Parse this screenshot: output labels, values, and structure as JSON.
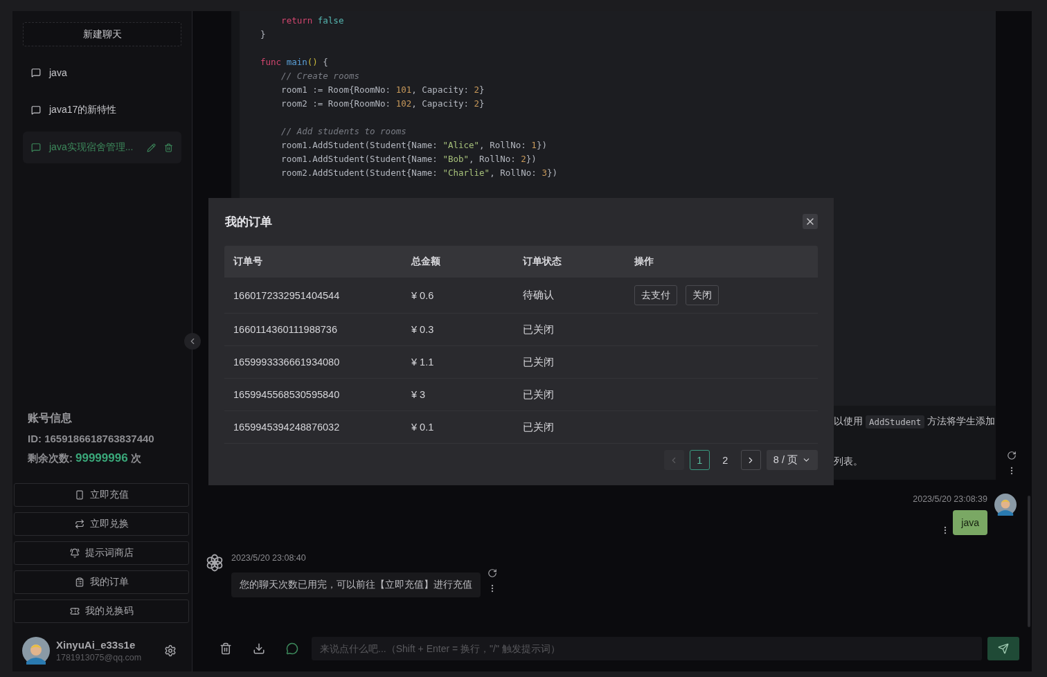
{
  "sidebar": {
    "new_chat_button": "新建聊天",
    "conversations": [
      {
        "title": "java",
        "selected": false
      },
      {
        "title": "java17的新特性",
        "selected": false
      },
      {
        "title": "java实现宿舍管理...",
        "selected": true
      }
    ],
    "account": {
      "title": "账号信息",
      "id": "ID: 1659186618763837440",
      "remaining_label": "剩余次数:",
      "remaining_value": "99999996",
      "remaining_unit": "次"
    },
    "actions": [
      {
        "kind": "recharge",
        "label": "立即充值"
      },
      {
        "kind": "exchange",
        "label": "立即兑换"
      },
      {
        "kind": "prompts",
        "label": "提示词商店"
      },
      {
        "kind": "orders",
        "label": "我的订单"
      },
      {
        "kind": "codes",
        "label": "我的兑换码"
      }
    ],
    "user": {
      "name": "XinyuAi_e33s1e",
      "email": "1781913075@qq.com"
    }
  },
  "chat": {
    "messages": [
      {
        "kind": "assistant",
        "code_lines": [
          {
            "gap_before": false,
            "tokens": [
              {
                "kind": "keyword",
                "text": "    return"
              },
              {
                "kind": "literal",
                "text": " false"
              }
            ]
          },
          {
            "gap_before": false,
            "tokens": [
              {
                "kind": "plain",
                "text": "}"
              }
            ]
          },
          {
            "gap_before": true,
            "tokens": [
              {
                "kind": "keyword",
                "text": "func"
              },
              {
                "kind": "function",
                "text": " main"
              },
              {
                "kind": "paren",
                "text": "()"
              },
              {
                "kind": "plain",
                "text": " {"
              }
            ]
          },
          {
            "gap_before": false,
            "tokens": [
              {
                "kind": "comment",
                "text": "    // Create rooms"
              }
            ]
          },
          {
            "gap_before": false,
            "tokens": [
              {
                "kind": "plain",
                "text": "    room1 := Room{RoomNo: "
              },
              {
                "kind": "number",
                "text": "101"
              },
              {
                "kind": "plain",
                "text": ", Capacity: "
              },
              {
                "kind": "number",
                "text": "2"
              },
              {
                "kind": "plain",
                "text": "}"
              }
            ]
          },
          {
            "gap_before": false,
            "tokens": [
              {
                "kind": "plain",
                "text": "    room2 := Room{RoomNo: "
              },
              {
                "kind": "number",
                "text": "102"
              },
              {
                "kind": "plain",
                "text": ", Capacity: "
              },
              {
                "kind": "number",
                "text": "2"
              },
              {
                "kind": "plain",
                "text": "}"
              }
            ]
          },
          {
            "gap_before": true,
            "tokens": [
              {
                "kind": "comment",
                "text": "    // Add students to rooms"
              }
            ]
          },
          {
            "gap_before": false,
            "tokens": [
              {
                "kind": "plain",
                "text": "    room1.AddStudent(Student{Name: "
              },
              {
                "kind": "string",
                "text": "\"Alice\""
              },
              {
                "kind": "plain",
                "text": ", RollNo: "
              },
              {
                "kind": "number",
                "text": "1"
              },
              {
                "kind": "plain",
                "text": "})"
              }
            ]
          },
          {
            "gap_before": false,
            "tokens": [
              {
                "kind": "plain",
                "text": "    room1.AddStudent(Student{Name: "
              },
              {
                "kind": "string",
                "text": "\"Bob\""
              },
              {
                "kind": "plain",
                "text": ", RollNo: "
              },
              {
                "kind": "number",
                "text": "2"
              },
              {
                "kind": "plain",
                "text": "})"
              }
            ]
          },
          {
            "gap_before": false,
            "tokens": [
              {
                "kind": "plain",
                "text": "    room2.AddStudent(Student{Name: "
              },
              {
                "kind": "string",
                "text": "\"Charlie\""
              },
              {
                "kind": "plain",
                "text": ", RollNo: "
              },
              {
                "kind": "number",
                "text": "3"
              },
              {
                "kind": "plain",
                "text": "})"
              }
            ]
          }
        ],
        "text_lines": [
          [
            {
              "kind": "text",
              "text": "以使用"
            },
            {
              "kind": "code",
              "text": "AddStudent"
            },
            {
              "kind": "text",
              "text": "方法将学生添加"
            }
          ],
          [
            {
              "kind": "text",
              "text": "列表。"
            }
          ]
        ]
      },
      {
        "kind": "user",
        "time": "2023/5/20 23:08:39",
        "text": "java"
      },
      {
        "kind": "assistant",
        "time": "2023/5/20 23:08:40",
        "text": "您的聊天次数已用完，可以前往【立即充值】进行充值"
      }
    ],
    "input": {
      "placeholder": "来说点什么吧...（Shift + Enter = 换行，\"/\" 触发提示词）"
    }
  },
  "modal": {
    "title": "我的订单",
    "columns": [
      "订单号",
      "总金额",
      "订单状态",
      "操作"
    ],
    "rows": [
      {
        "order_no": "1660172332951404544",
        "amount": "¥ 0.6",
        "status": "待确认",
        "actions": [
          "去支付",
          "关闭"
        ]
      },
      {
        "order_no": "1660114360111988736",
        "amount": "¥ 0.3",
        "status": "已关闭"
      },
      {
        "order_no": "1659993336661934080",
        "amount": "¥ 1.1",
        "status": "已关闭"
      },
      {
        "order_no": "1659945568530595840",
        "amount": "¥ 3",
        "status": "已关闭"
      },
      {
        "order_no": "1659945394248876032",
        "amount": "¥ 0.1",
        "status": "已关闭"
      }
    ],
    "pagination": {
      "prev_disabled": true,
      "next_disabled": false,
      "pages": [
        {
          "label": "1",
          "selected": true
        },
        {
          "label": "2",
          "selected": false
        }
      ],
      "page_size": "8 / 页"
    }
  }
}
